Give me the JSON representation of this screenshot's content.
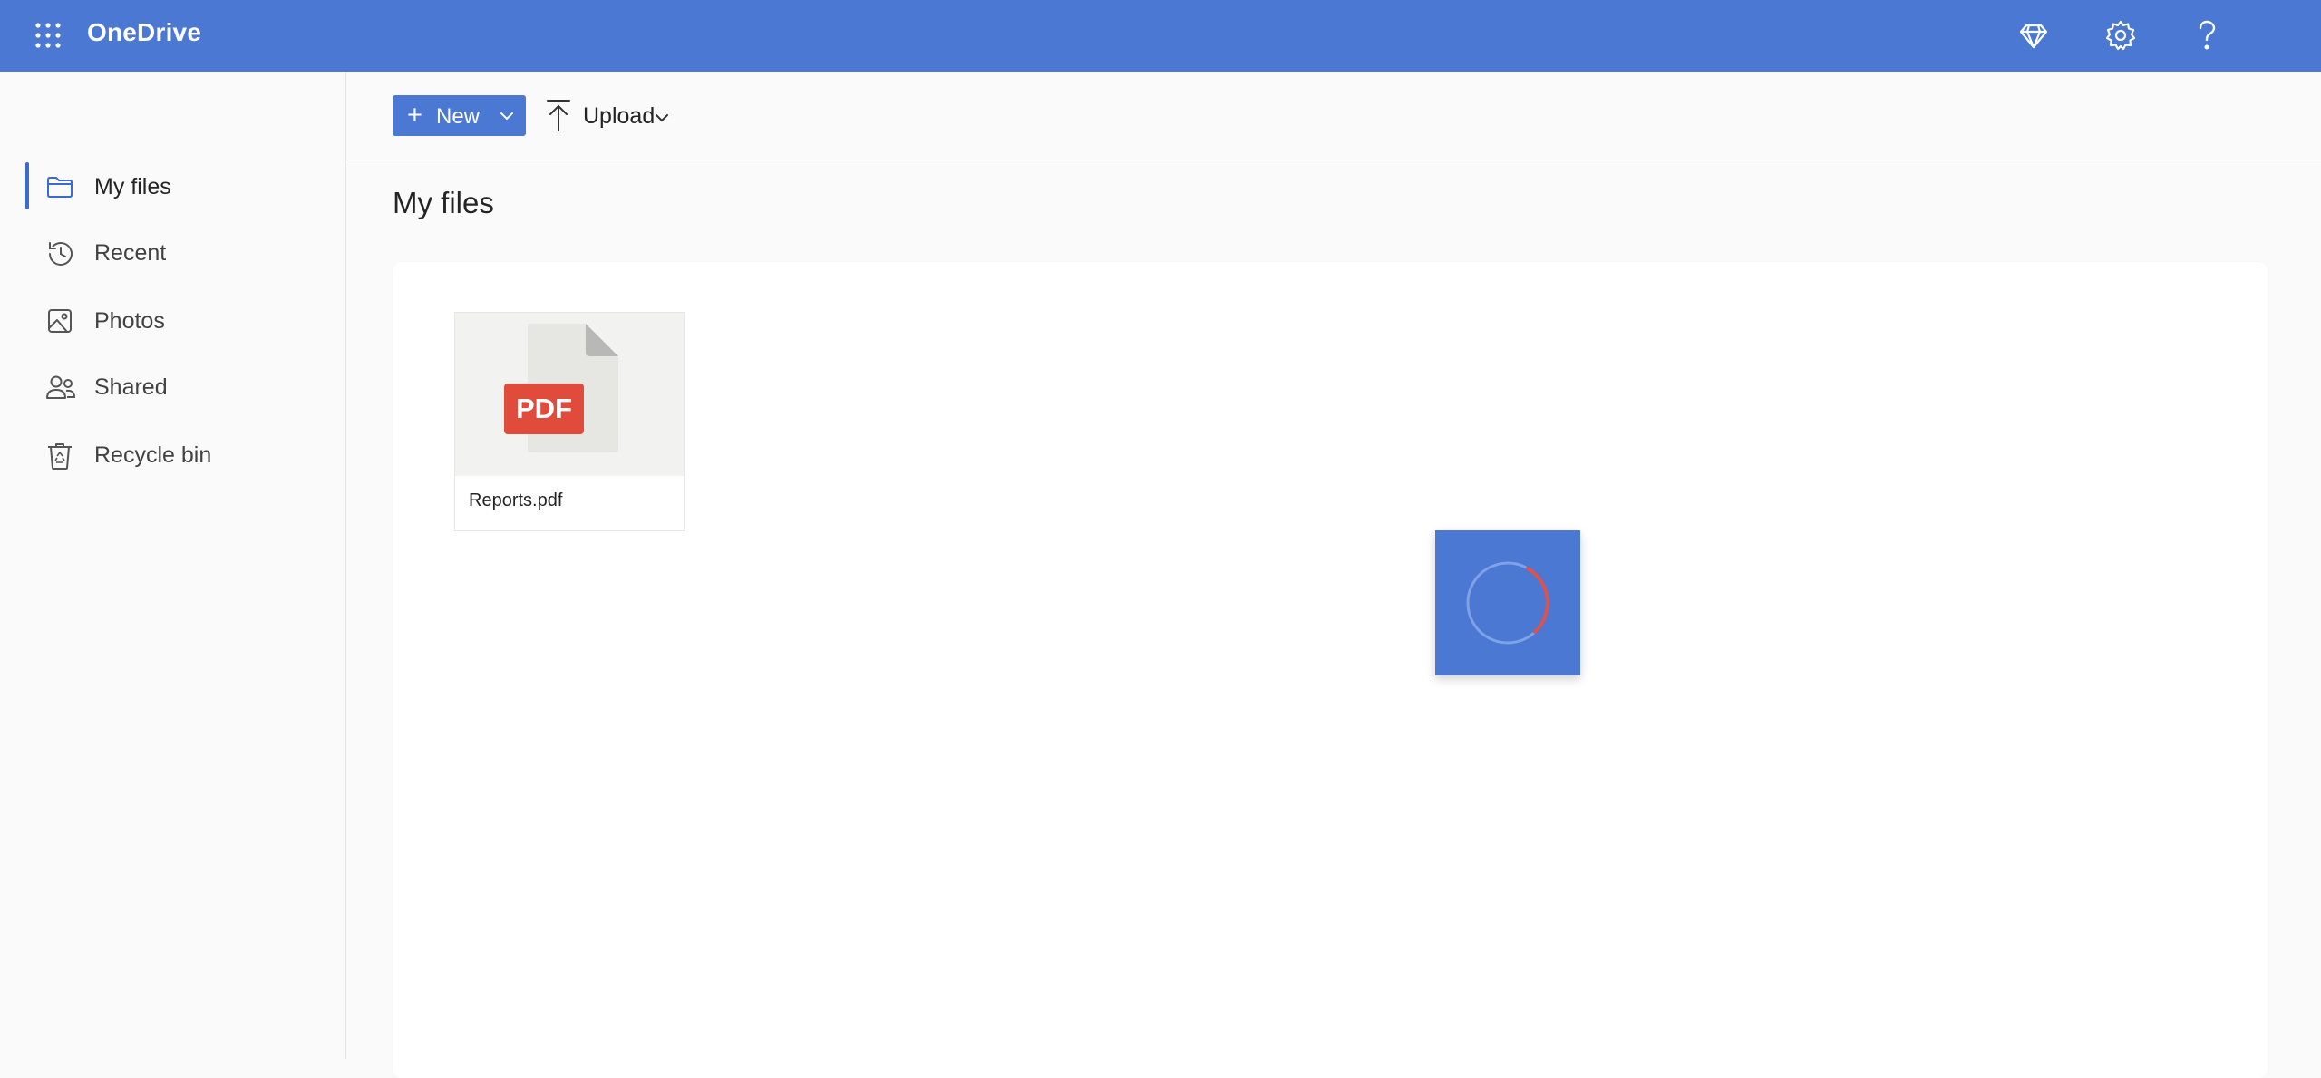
{
  "app": {
    "title": "OneDrive",
    "brand_color": "#4a78d3"
  },
  "header": {
    "icons": [
      "waffle-icon",
      "premium-diamond-icon",
      "settings-gear-icon",
      "help-question-icon"
    ]
  },
  "sidebar": {
    "items": [
      {
        "label": "My files",
        "icon": "folder-icon",
        "active": true
      },
      {
        "label": "Recent",
        "icon": "recent-clock-icon",
        "active": false
      },
      {
        "label": "Photos",
        "icon": "photo-icon",
        "active": false
      },
      {
        "label": "Shared",
        "icon": "people-icon",
        "active": false
      },
      {
        "label": "Recycle bin",
        "icon": "recycle-bin-icon",
        "active": false
      }
    ]
  },
  "toolbar": {
    "new_label": "New",
    "upload_label": "Upload"
  },
  "main": {
    "title": "My files",
    "files": [
      {
        "name": "Reports.pdf",
        "type_badge": "PDF",
        "badge_color": "#e04b3b"
      }
    ]
  },
  "loading": {
    "spinner_accent": "#d9534f"
  }
}
